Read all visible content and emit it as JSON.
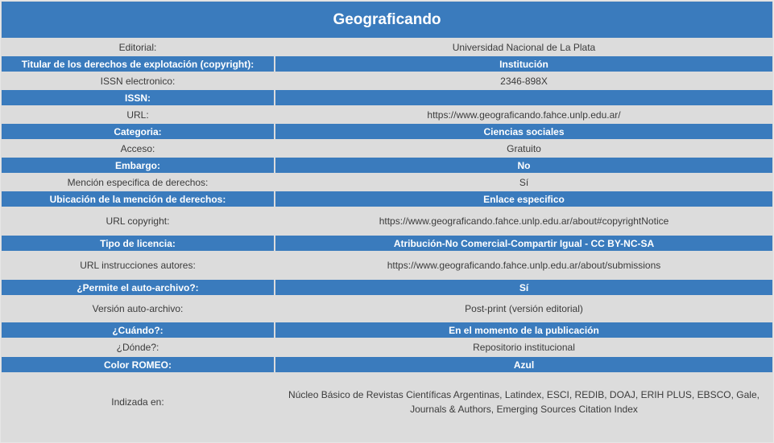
{
  "title": "Geograficando",
  "rows": [
    {
      "label": "Editorial:",
      "value": "Universidad Nacional de La Plata"
    },
    {
      "label": "Titular de los derechos de explotación (copyright):",
      "value": "Institución"
    },
    {
      "label": "ISSN electronico:",
      "value": "2346-898X"
    },
    {
      "label": "ISSN:",
      "value": ""
    },
    {
      "label": "URL:",
      "value": "https://www.geograficando.fahce.unlp.edu.ar/"
    },
    {
      "label": "Categoria:",
      "value": "Ciencias sociales"
    },
    {
      "label": "Acceso:",
      "value": "Gratuito"
    },
    {
      "label": "Embargo:",
      "value": "No"
    },
    {
      "label": "Mención especifica de derechos:",
      "value": "Sí"
    },
    {
      "label": "Ubicación de la mención de derechos:",
      "value": "Enlace especifico"
    },
    {
      "label": "URL copyright:",
      "value": "https://www.geograficando.fahce.unlp.edu.ar/about#copyrightNotice"
    },
    {
      "label": "Tipo de licencia:",
      "value": "Atribución-No Comercial-Compartir Igual - CC BY-NC-SA"
    },
    {
      "label": "URL instrucciones autores:",
      "value": "https://www.geograficando.fahce.unlp.edu.ar/about/submissions"
    },
    {
      "label": "¿Permite el auto-archivo?:",
      "value": "Sí"
    },
    {
      "label": "Versión auto-archivo:",
      "value": "Post-print (versión editorial)"
    },
    {
      "label": "¿Cuándo?:",
      "value": "En el momento de la publicación"
    },
    {
      "label": "¿Dónde?:",
      "value": "Repositorio institucional"
    },
    {
      "label": "Color ROMEO:",
      "value": "Azul"
    },
    {
      "label": "Indizada en:",
      "value": "Núcleo Básico de Revistas Científicas Argentinas, Latindex, ESCI, REDIB, DOAJ, ERIH PLUS, EBSCO, Gale, Journals & Authors, Emerging Sources Citation Index"
    }
  ]
}
